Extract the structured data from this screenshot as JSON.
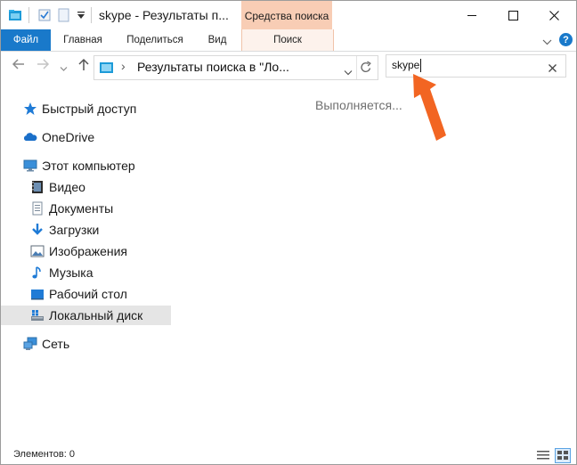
{
  "titlebar": {
    "title": "skype - Результаты п...",
    "context_tab_group": "Средства поиска",
    "minimize_icon": "minimize-icon",
    "maximize_icon": "maximize-icon",
    "close_icon": "close-icon"
  },
  "ribbon": {
    "tabs": [
      {
        "label": "Файл"
      },
      {
        "label": "Главная"
      },
      {
        "label": "Поделиться"
      },
      {
        "label": "Вид"
      },
      {
        "label": "Поиск"
      }
    ],
    "help_label": "?"
  },
  "address": {
    "path": "Результаты поиска в \"Ло...",
    "separator": "›"
  },
  "search": {
    "value": "skype"
  },
  "nav": {
    "items": [
      {
        "label": "Быстрый доступ",
        "icon": "star-icon"
      },
      {
        "label": "OneDrive",
        "icon": "cloud-icon"
      },
      {
        "label": "Этот компьютер",
        "icon": "computer-icon"
      },
      {
        "label": "Видео",
        "icon": "video-icon"
      },
      {
        "label": "Документы",
        "icon": "document-icon"
      },
      {
        "label": "Загрузки",
        "icon": "download-icon"
      },
      {
        "label": "Изображения",
        "icon": "image-icon"
      },
      {
        "label": "Музыка",
        "icon": "music-icon"
      },
      {
        "label": "Рабочий стол",
        "icon": "desktop-icon"
      },
      {
        "label": "Локальный диск",
        "icon": "drive-icon"
      },
      {
        "label": "Сеть",
        "icon": "network-icon"
      }
    ]
  },
  "content": {
    "status": "Выполняется..."
  },
  "statusbar": {
    "items_count": "Элементов: 0"
  },
  "colors": {
    "accent": "#1979ca",
    "context_tab": "#f8cdb5",
    "arrow": "#f26522"
  }
}
